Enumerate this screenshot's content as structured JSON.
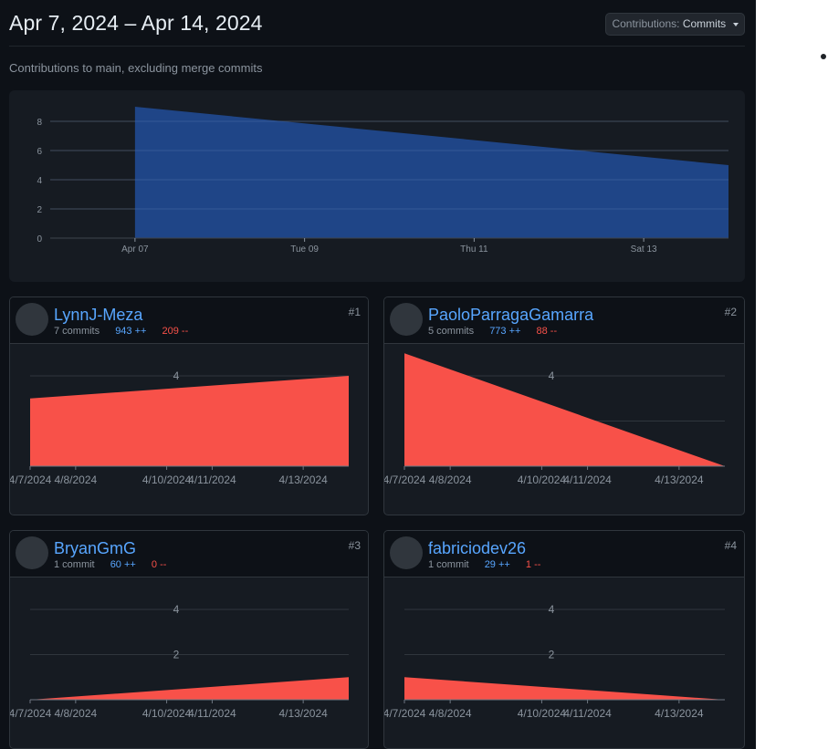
{
  "header": {
    "title": "Apr 7, 2024 – Apr 14, 2024",
    "selector_prefix": "Contributions:",
    "selector_value": "Commits",
    "subtitle": "Contributions to main, excluding merge commits"
  },
  "colors": {
    "main_area": "#1f4587",
    "contributor_area": "#f85149",
    "link": "#58a6ff",
    "additions": "#58a6ff",
    "deletions": "#f85149"
  },
  "chart_data": [
    {
      "type": "area",
      "x": [
        "2024-04-07",
        "2024-04-14"
      ],
      "y": [
        9,
        5
      ],
      "xlim": [
        "2024-04-06",
        "2024-04-14"
      ],
      "ylim": [
        0,
        9
      ],
      "yticks": [
        0,
        2,
        4,
        6,
        8
      ],
      "xticks": [
        {
          "date": "2024-04-07",
          "label": "Apr 07"
        },
        {
          "date": "2024-04-09",
          "label": "Tue 09"
        },
        {
          "date": "2024-04-11",
          "label": "Thu 11"
        },
        {
          "date": "2024-04-13",
          "label": "Sat 13"
        }
      ],
      "grid": true
    },
    {
      "type": "area",
      "x": [
        "2024-04-07",
        "2024-04-14"
      ],
      "y": [
        3,
        4
      ],
      "xlim": [
        "2024-04-07",
        "2024-04-14"
      ],
      "ylim": [
        0,
        4
      ],
      "yticks": [
        {
          "v": 4,
          "label": "4"
        }
      ],
      "xticks": [
        {
          "date": "2024-04-07",
          "label": "4/7/2024"
        },
        {
          "date": "2024-04-08",
          "label": "4/8/2024"
        },
        {
          "date": "2024-04-10",
          "label": "4/10/2024"
        },
        {
          "date": "2024-04-11",
          "label": "4/11/2024"
        },
        {
          "date": "2024-04-13",
          "label": "4/13/2024"
        }
      ]
    },
    {
      "type": "area",
      "x": [
        "2024-04-07",
        "2024-04-14"
      ],
      "y": [
        5,
        0
      ],
      "xlim": [
        "2024-04-07",
        "2024-04-14"
      ],
      "ylim": [
        0,
        4
      ],
      "yticks": [
        {
          "v": 2,
          "label": ""
        },
        {
          "v": 4,
          "label": "4"
        }
      ],
      "xticks": [
        {
          "date": "2024-04-07",
          "label": "4/7/2024"
        },
        {
          "date": "2024-04-08",
          "label": "4/8/2024"
        },
        {
          "date": "2024-04-10",
          "label": "4/10/2024"
        },
        {
          "date": "2024-04-11",
          "label": "4/11/2024"
        },
        {
          "date": "2024-04-13",
          "label": "4/13/2024"
        }
      ]
    },
    {
      "type": "area",
      "x": [
        "2024-04-07",
        "2024-04-14"
      ],
      "y": [
        0,
        1
      ],
      "xlim": [
        "2024-04-07",
        "2024-04-14"
      ],
      "ylim": [
        0,
        4
      ],
      "yticks": [
        {
          "v": 2,
          "label": "2"
        },
        {
          "v": 4,
          "label": "4"
        }
      ],
      "xticks": [
        {
          "date": "2024-04-07",
          "label": "4/7/2024"
        },
        {
          "date": "2024-04-08",
          "label": "4/8/2024"
        },
        {
          "date": "2024-04-10",
          "label": "4/10/2024"
        },
        {
          "date": "2024-04-11",
          "label": "4/11/2024"
        },
        {
          "date": "2024-04-13",
          "label": "4/13/2024"
        }
      ]
    },
    {
      "type": "area",
      "x": [
        "2024-04-07",
        "2024-04-14"
      ],
      "y": [
        1,
        0
      ],
      "xlim": [
        "2024-04-07",
        "2024-04-14"
      ],
      "ylim": [
        0,
        4
      ],
      "yticks": [
        {
          "v": 2,
          "label": "2"
        },
        {
          "v": 4,
          "label": "4"
        }
      ],
      "xticks": [
        {
          "date": "2024-04-07",
          "label": "4/7/2024"
        },
        {
          "date": "2024-04-08",
          "label": "4/8/2024"
        },
        {
          "date": "2024-04-10",
          "label": "4/10/2024"
        },
        {
          "date": "2024-04-11",
          "label": "4/11/2024"
        },
        {
          "date": "2024-04-13",
          "label": "4/13/2024"
        }
      ]
    }
  ],
  "contributors": [
    {
      "rank": "#1",
      "name": "LynnJ-Meza",
      "commits": "7 commits",
      "additions": "943 ++",
      "deletions": "209 --",
      "avatar_icon": "otter-avatar-icon"
    },
    {
      "rank": "#2",
      "name": "PaoloParragaGamarra",
      "commits": "5 commits",
      "additions": "773 ++",
      "deletions": "88 --",
      "avatar_icon": "person-avatar-icon"
    },
    {
      "rank": "#3",
      "name": "BryanGmG",
      "commits": "1 commit",
      "additions": "60 ++",
      "deletions": "0 --",
      "avatar_icon": "letter-b-avatar-icon"
    },
    {
      "rank": "#4",
      "name": "fabriciodev26",
      "commits": "1 commit",
      "additions": "29 ++",
      "deletions": "1 --",
      "avatar_icon": "cartoon-avatar-icon"
    }
  ]
}
